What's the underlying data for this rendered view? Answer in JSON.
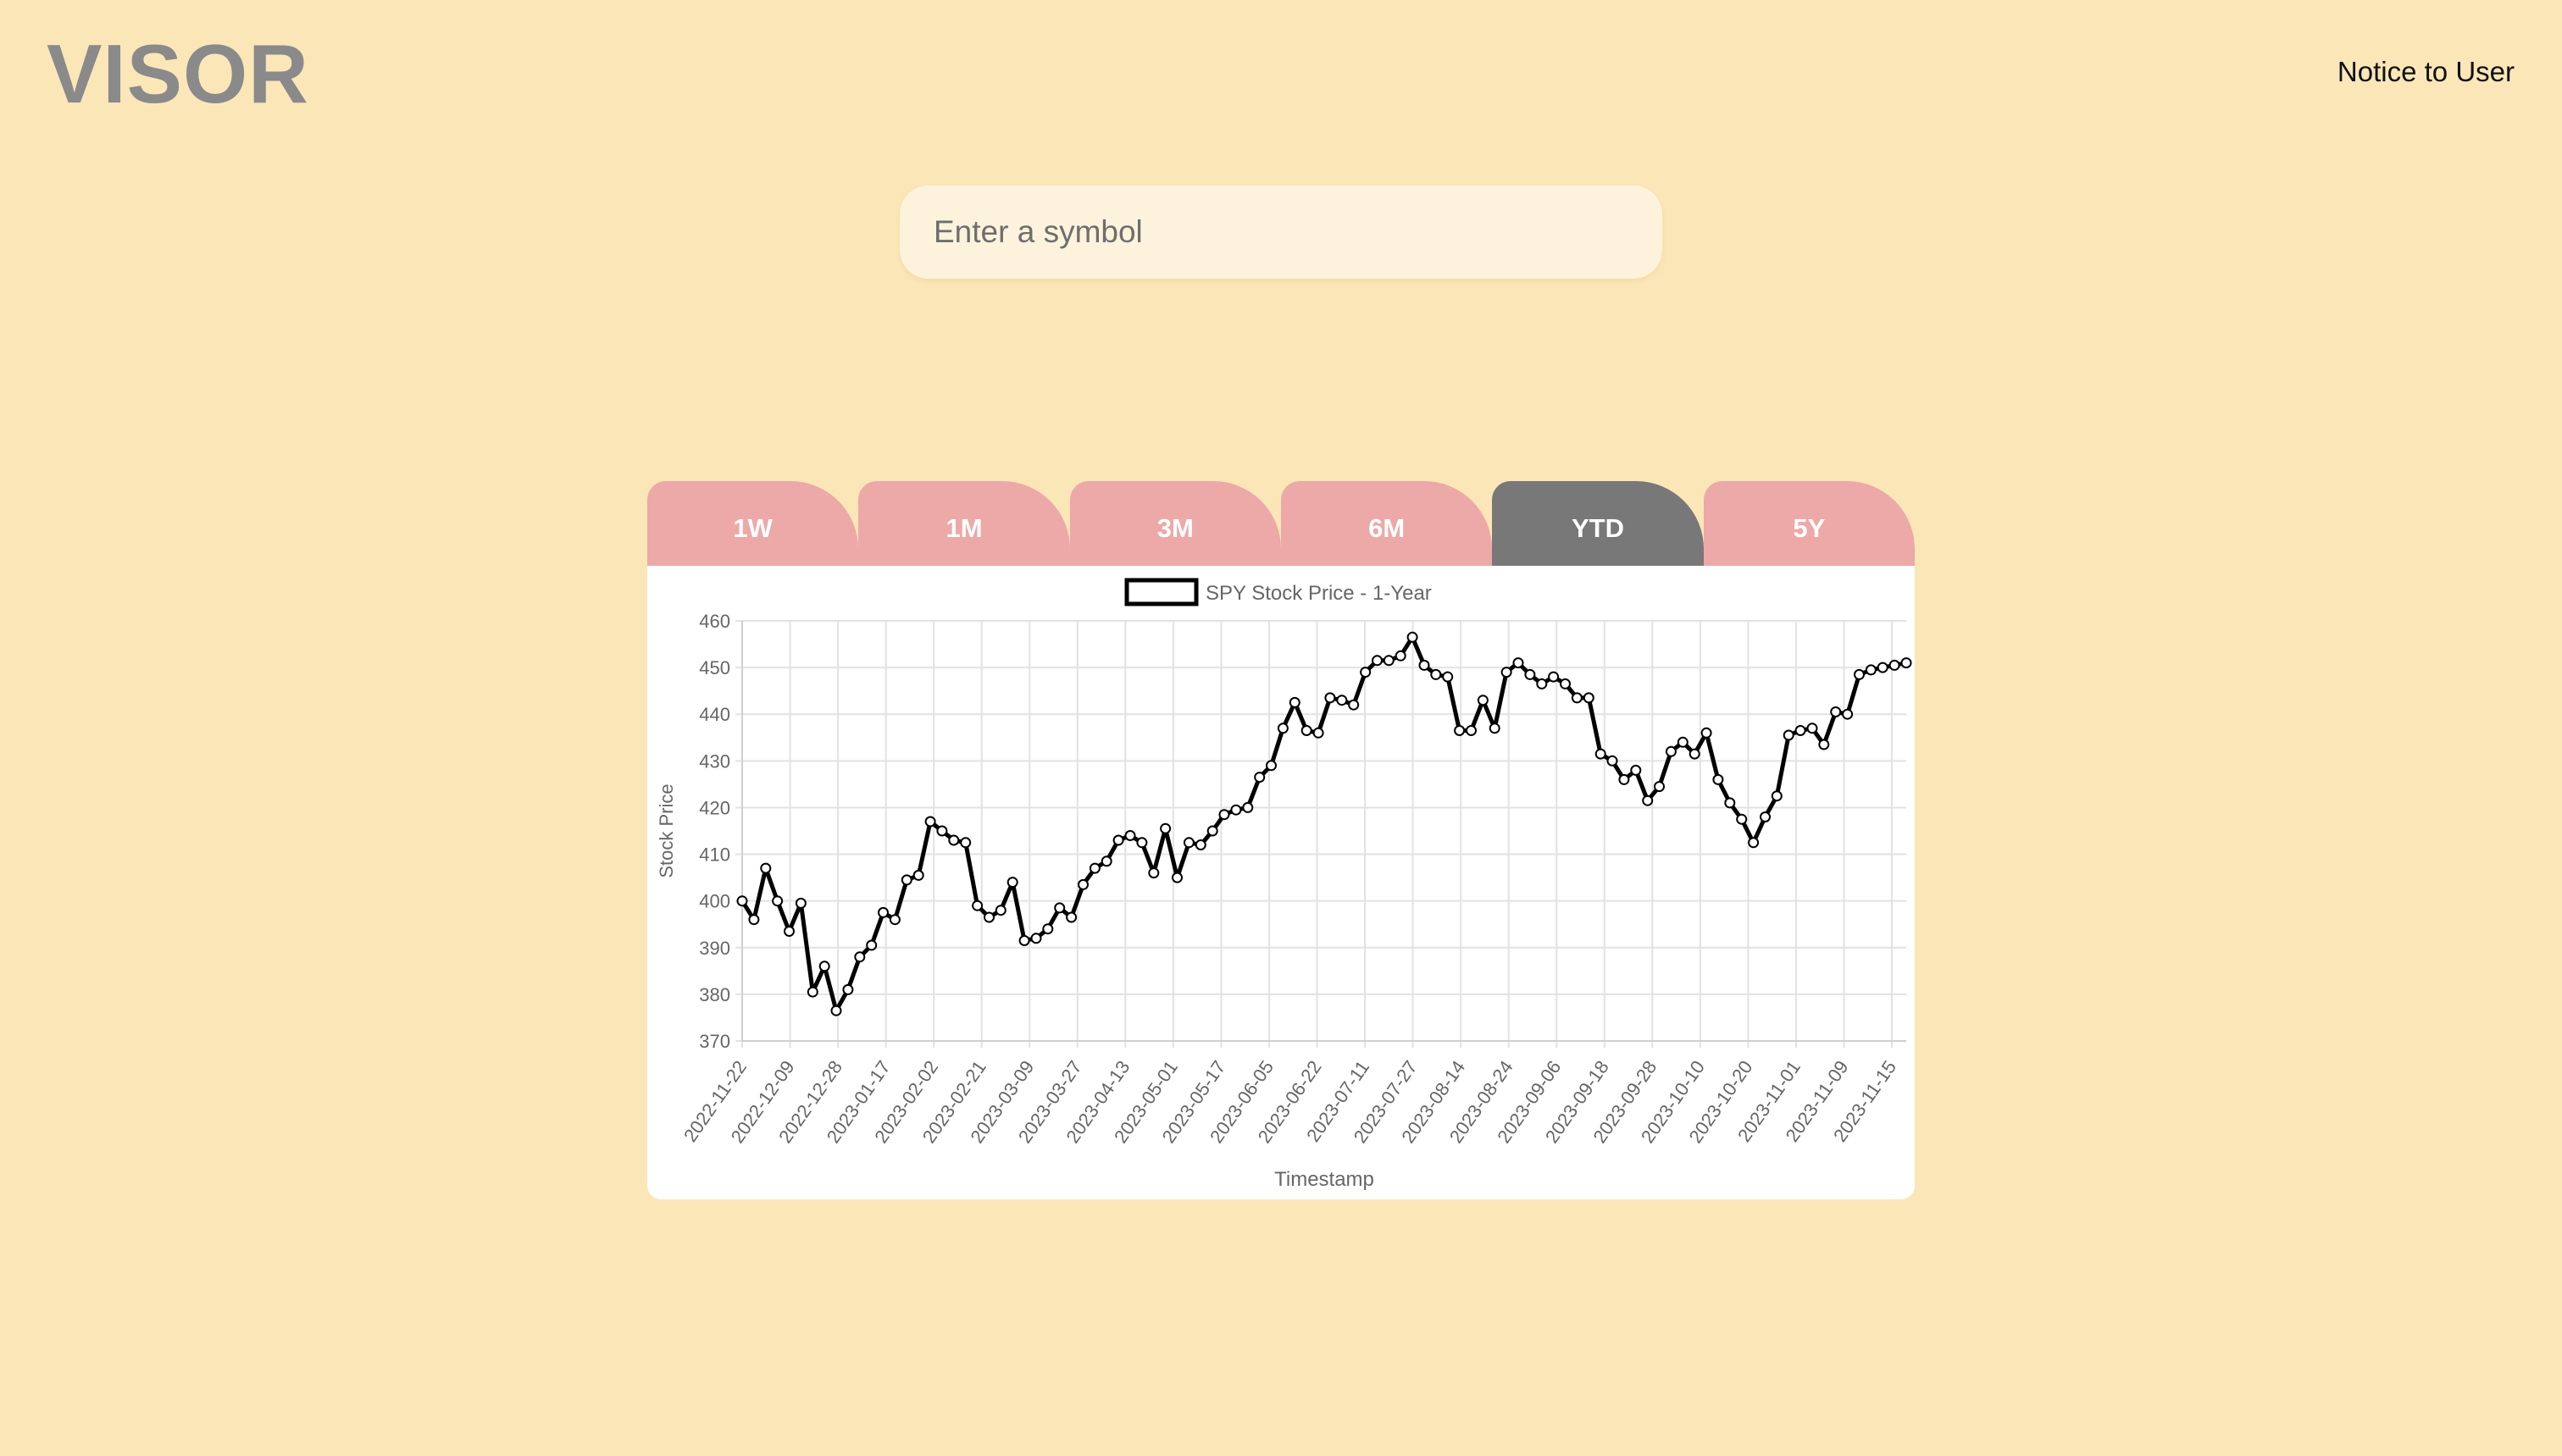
{
  "header": {
    "logo": "VISOR",
    "notice_link": "Notice to User"
  },
  "search": {
    "placeholder": "Enter a symbol",
    "value": ""
  },
  "tabs": [
    {
      "label": "1W",
      "active": false
    },
    {
      "label": "1M",
      "active": false
    },
    {
      "label": "3M",
      "active": false
    },
    {
      "label": "6M",
      "active": false
    },
    {
      "label": "YTD",
      "active": true
    },
    {
      "label": "5Y",
      "active": false
    }
  ],
  "colors": {
    "background": "#fbe6b8",
    "tab": "#eca9a8",
    "tab_active": "#787878",
    "line": "#000000"
  },
  "chart_data": {
    "type": "line",
    "title": "",
    "xlabel": "Timestamp",
    "ylabel": "Stock Price",
    "ylim": [
      370,
      460
    ],
    "yticks": [
      370,
      380,
      390,
      400,
      410,
      420,
      430,
      440,
      450,
      460
    ],
    "grid": true,
    "legend": "top-center",
    "tick_labels": [
      "2022-11-22",
      "2022-12-09",
      "2022-12-28",
      "2023-01-17",
      "2023-02-02",
      "2023-02-21",
      "2023-03-09",
      "2023-03-27",
      "2023-04-13",
      "2023-05-01",
      "2023-05-17",
      "2023-06-05",
      "2023-06-22",
      "2023-07-11",
      "2023-07-27",
      "2023-08-14",
      "2023-08-24",
      "2023-09-06",
      "2023-09-18",
      "2023-09-28",
      "2023-10-10",
      "2023-10-20",
      "2023-11-01",
      "2023-11-09",
      "2023-11-15"
    ],
    "series": [
      {
        "name": "SPY Stock Price - 1-Year",
        "values": [
          400,
          396,
          407,
          400,
          393.5,
          399.5,
          380.5,
          386,
          376.5,
          381,
          388,
          390.5,
          397.5,
          396,
          404.5,
          405.5,
          417,
          415,
          413,
          412.5,
          399,
          396.5,
          398,
          404,
          391.5,
          392,
          394,
          398.5,
          396.5,
          403.5,
          407,
          408.5,
          413,
          414,
          412.5,
          406,
          415.5,
          405,
          412.5,
          412,
          415,
          418.5,
          419.5,
          420,
          426.5,
          429,
          437,
          442.5,
          436.5,
          436,
          443.5,
          443,
          442,
          449,
          451.5,
          451.5,
          452.5,
          456.5,
          450.5,
          448.5,
          448,
          436.5,
          436.5,
          443,
          437,
          449,
          451,
          448.5,
          446.5,
          448,
          446.5,
          443.5,
          443.5,
          431.5,
          430,
          426,
          428,
          421.5,
          424.5,
          432,
          434,
          431.5,
          436,
          426,
          421,
          417.5,
          412.5,
          418,
          422.5,
          435.5,
          436.5,
          437,
          433.5,
          440.5,
          440,
          448.5,
          449.5,
          450,
          450.5,
          451
        ]
      }
    ]
  }
}
